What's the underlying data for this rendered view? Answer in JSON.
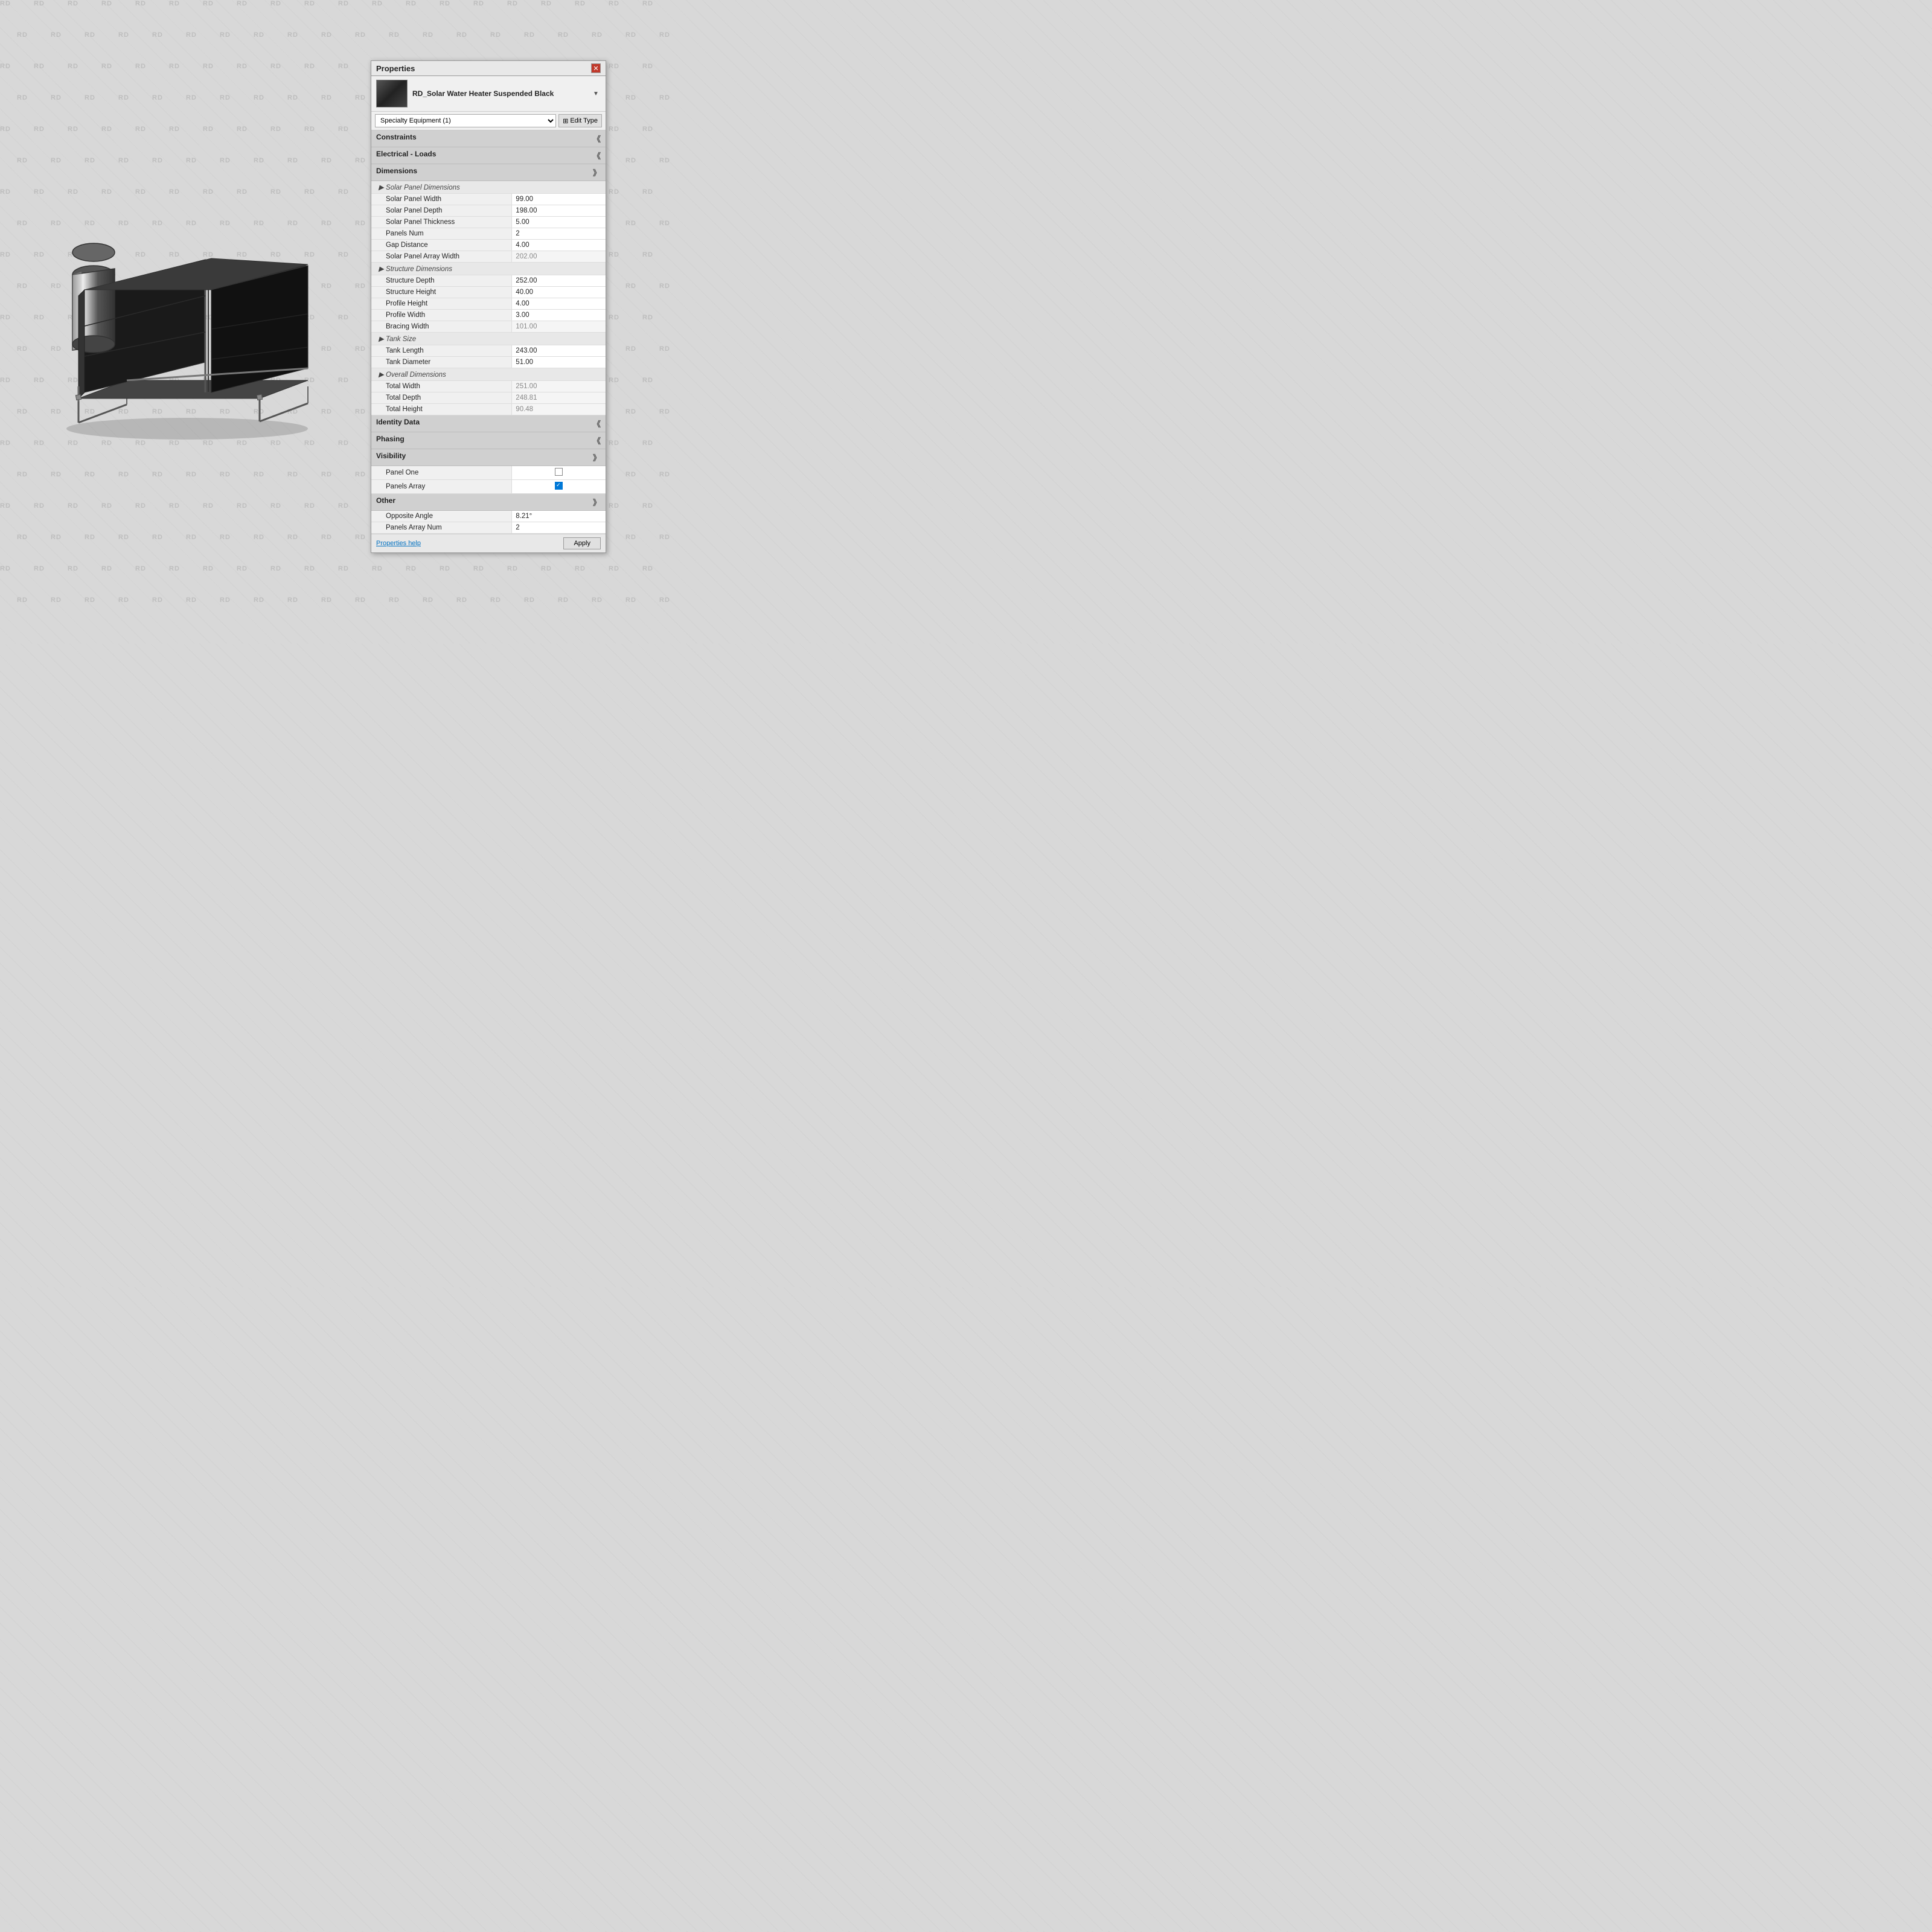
{
  "watermarks": [
    "RD"
  ],
  "panel": {
    "title": "Properties",
    "close_label": "✕",
    "component_name": "RD_Solar Water Heater Suspended Black",
    "type_selector": "Specialty Equipment (1)",
    "edit_type_label": "Edit Type",
    "sections": [
      {
        "id": "constraints",
        "label": "Constraints",
        "collapsed": true,
        "rows": []
      },
      {
        "id": "electrical_loads",
        "label": "Electrical - Loads",
        "collapsed": true,
        "rows": []
      },
      {
        "id": "dimensions",
        "label": "Dimensions",
        "collapsed": false,
        "rows": [
          {
            "type": "subheader",
            "label": "▶ Solar Panel Dimensions"
          },
          {
            "type": "row",
            "label": "Solar Panel Width",
            "value": "99.00"
          },
          {
            "type": "row",
            "label": "Solar Panel Depth",
            "value": "198.00"
          },
          {
            "type": "row",
            "label": "Solar Panel Thickness",
            "value": "5.00"
          },
          {
            "type": "row",
            "label": "Panels Num",
            "value": "2"
          },
          {
            "type": "row",
            "label": "Gap Distance",
            "value": "4.00"
          },
          {
            "type": "row",
            "label": "Solar Panel Array Width",
            "value": "202.00",
            "gray": true
          },
          {
            "type": "subheader",
            "label": "▶ Structure Dimensions"
          },
          {
            "type": "row",
            "label": "Structure Depth",
            "value": "252.00"
          },
          {
            "type": "row",
            "label": "Structure Height",
            "value": "40.00"
          },
          {
            "type": "row",
            "label": "Profile Height",
            "value": "4.00"
          },
          {
            "type": "row",
            "label": "Profile Width",
            "value": "3.00"
          },
          {
            "type": "row",
            "label": "Bracing Width",
            "value": "101.00",
            "gray": true
          },
          {
            "type": "subheader",
            "label": "▶ Tank Size"
          },
          {
            "type": "row",
            "label": "Tank Length",
            "value": "243.00"
          },
          {
            "type": "row",
            "label": "Tank Diameter",
            "value": "51.00"
          },
          {
            "type": "subheader",
            "label": "▶ Overall Dimensions"
          },
          {
            "type": "row",
            "label": "Total Width",
            "value": "251.00",
            "gray": true
          },
          {
            "type": "row",
            "label": "Total Depth",
            "value": "248.81",
            "gray": true
          },
          {
            "type": "row",
            "label": "Total Height",
            "value": "90.48",
            "gray": true
          }
        ]
      },
      {
        "id": "identity_data",
        "label": "Identity Data",
        "collapsed": true,
        "rows": []
      },
      {
        "id": "phasing",
        "label": "Phasing",
        "collapsed": true,
        "rows": []
      },
      {
        "id": "visibility",
        "label": "Visibility",
        "collapsed": false,
        "rows": [
          {
            "type": "row",
            "label": "Panel One",
            "value": "checkbox_unchecked"
          },
          {
            "type": "row",
            "label": "Panels Array",
            "value": "checkbox_checked"
          }
        ]
      },
      {
        "id": "other",
        "label": "Other",
        "collapsed": false,
        "rows": [
          {
            "type": "row",
            "label": "Opposite Angle",
            "value": "8.21°"
          },
          {
            "type": "row",
            "label": "Panels Array Num",
            "value": "2"
          }
        ]
      }
    ],
    "bottom": {
      "help_label": "Properties help",
      "apply_label": "Apply"
    }
  }
}
